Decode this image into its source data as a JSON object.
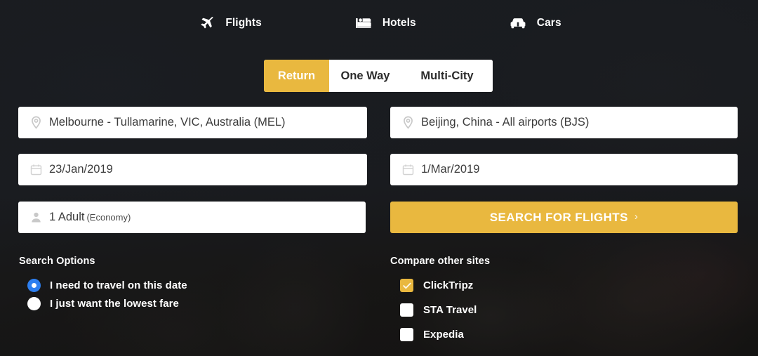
{
  "nav": {
    "items": [
      {
        "label": "Flights",
        "icon": "plane-icon"
      },
      {
        "label": "Hotels",
        "icon": "bed-icon"
      },
      {
        "label": "Cars",
        "icon": "car-icon"
      }
    ]
  },
  "trip_tabs": {
    "items": [
      {
        "label": "Return",
        "active": true
      },
      {
        "label": "One Way",
        "active": false
      },
      {
        "label": "Multi-City",
        "active": false
      }
    ]
  },
  "form": {
    "origin": {
      "value": "Melbourne - Tullamarine, VIC, Australia (MEL)",
      "placeholder": "From",
      "icon": "location-pin-icon"
    },
    "destination": {
      "value": "Beijing, China - All airports (BJS)",
      "placeholder": "To",
      "icon": "location-pin-icon"
    },
    "depart_date": {
      "value": "23/Jan/2019",
      "placeholder": "Depart",
      "icon": "calendar-icon"
    },
    "return_date": {
      "value": "1/Mar/2019",
      "placeholder": "Return",
      "icon": "calendar-icon"
    },
    "passengers": {
      "value": "1 Adult",
      "cabin_class": "(Economy)",
      "icon": "person-icon"
    },
    "search_button": {
      "label": "SEARCH FOR FLIGHTS",
      "chevron": "›"
    }
  },
  "search_options": {
    "heading": "Search Options",
    "options": [
      {
        "label": "I need to travel on this date",
        "selected": true
      },
      {
        "label": "I just want the lowest fare",
        "selected": false
      }
    ]
  },
  "compare_sites": {
    "heading": "Compare other sites",
    "sites": [
      {
        "label": "ClickTripz",
        "checked": true
      },
      {
        "label": "STA Travel",
        "checked": false
      },
      {
        "label": "Expedia",
        "checked": false
      }
    ]
  },
  "colors": {
    "accent_gold": "#e9b83f",
    "radio_blue": "#2d7ff0",
    "background_dark": "#1a1d21",
    "field_white": "#ffffff",
    "text_dark": "#3c3c3c"
  }
}
